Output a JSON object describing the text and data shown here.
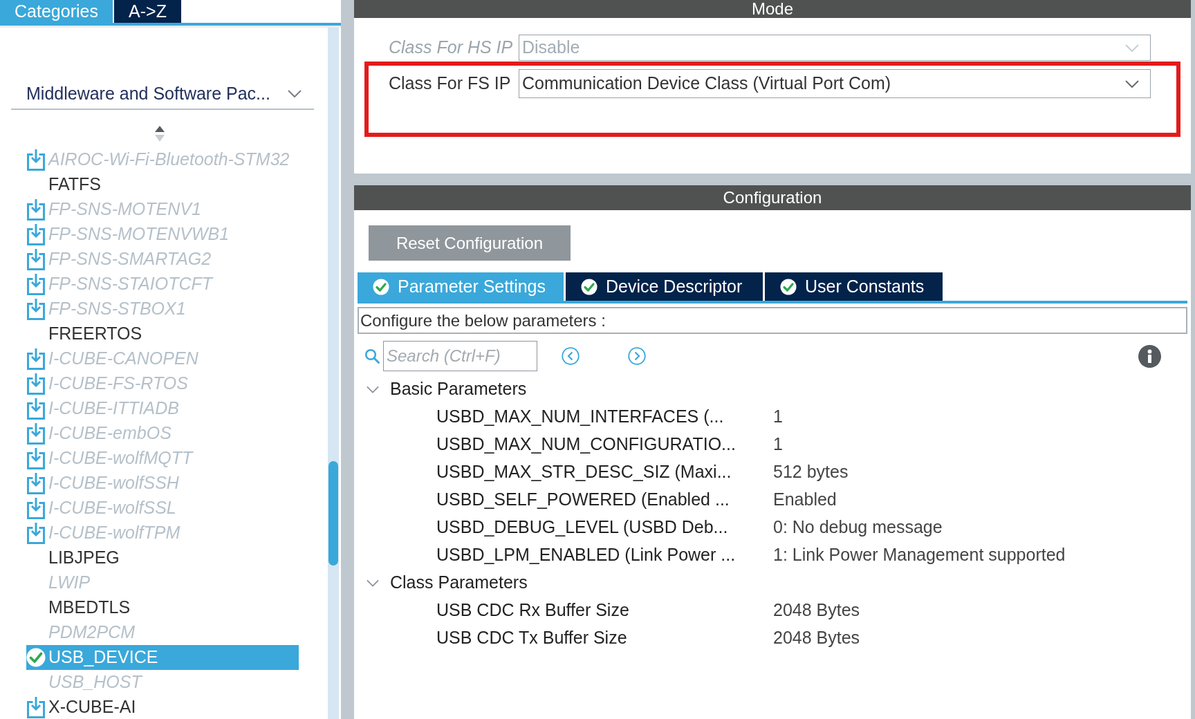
{
  "sidebar": {
    "tabs": [
      {
        "label": "Categories",
        "selected": true
      },
      {
        "label": "A->Z",
        "selected": false
      }
    ],
    "category_dropdown": {
      "value": "Middleware and Software Pac..."
    },
    "items": [
      {
        "label": "AIROC-Wi-Fi-Bluetooth-STM32",
        "kind": "pack",
        "available": false,
        "configured": false,
        "selected": false
      },
      {
        "label": "FATFS",
        "kind": "component",
        "available": true,
        "configured": false,
        "selected": false
      },
      {
        "label": "FP-SNS-MOTENV1",
        "kind": "pack",
        "available": false,
        "configured": false,
        "selected": false
      },
      {
        "label": "FP-SNS-MOTENVWB1",
        "kind": "pack",
        "available": false,
        "configured": false,
        "selected": false
      },
      {
        "label": "FP-SNS-SMARTAG2",
        "kind": "pack",
        "available": false,
        "configured": false,
        "selected": false
      },
      {
        "label": "FP-SNS-STAIOTCFT",
        "kind": "pack",
        "available": false,
        "configured": false,
        "selected": false
      },
      {
        "label": "FP-SNS-STBOX1",
        "kind": "pack",
        "available": false,
        "configured": false,
        "selected": false
      },
      {
        "label": "FREERTOS",
        "kind": "component",
        "available": true,
        "configured": false,
        "selected": false
      },
      {
        "label": "I-CUBE-CANOPEN",
        "kind": "pack",
        "available": false,
        "configured": false,
        "selected": false
      },
      {
        "label": "I-CUBE-FS-RTOS",
        "kind": "pack",
        "available": false,
        "configured": false,
        "selected": false
      },
      {
        "label": "I-CUBE-ITTIADB",
        "kind": "pack",
        "available": false,
        "configured": false,
        "selected": false
      },
      {
        "label": "I-CUBE-embOS",
        "kind": "pack",
        "available": false,
        "configured": false,
        "selected": false
      },
      {
        "label": "I-CUBE-wolfMQTT",
        "kind": "pack",
        "available": false,
        "configured": false,
        "selected": false
      },
      {
        "label": "I-CUBE-wolfSSH",
        "kind": "pack",
        "available": false,
        "configured": false,
        "selected": false
      },
      {
        "label": "I-CUBE-wolfSSL",
        "kind": "pack",
        "available": false,
        "configured": false,
        "selected": false
      },
      {
        "label": "I-CUBE-wolfTPM",
        "kind": "pack",
        "available": false,
        "configured": false,
        "selected": false
      },
      {
        "label": "LIBJPEG",
        "kind": "component",
        "available": true,
        "configured": false,
        "selected": false
      },
      {
        "label": "LWIP",
        "kind": "component",
        "available": false,
        "configured": false,
        "selected": false
      },
      {
        "label": "MBEDTLS",
        "kind": "component",
        "available": true,
        "configured": false,
        "selected": false
      },
      {
        "label": "PDM2PCM",
        "kind": "component",
        "available": false,
        "configured": false,
        "selected": false
      },
      {
        "label": "USB_DEVICE",
        "kind": "component",
        "available": true,
        "configured": true,
        "selected": true
      },
      {
        "label": "USB_HOST",
        "kind": "component",
        "available": false,
        "configured": false,
        "selected": false
      },
      {
        "label": "X-CUBE-AI",
        "kind": "pack",
        "available": true,
        "configured": false,
        "selected": false
      }
    ]
  },
  "mode": {
    "title": "Mode",
    "fields": [
      {
        "label": "Class For HS IP",
        "value": "Disable",
        "disabled": true,
        "highlighted": false
      },
      {
        "label": "Class For FS IP",
        "value": "Communication Device Class (Virtual Port Com)",
        "disabled": false,
        "highlighted": true
      }
    ]
  },
  "configuration": {
    "title": "Configuration",
    "reset_button": "Reset Configuration",
    "tabs": [
      {
        "label": "Parameter Settings",
        "selected": true,
        "valid": true
      },
      {
        "label": "Device Descriptor",
        "selected": false,
        "valid": true
      },
      {
        "label": "User Constants",
        "selected": false,
        "valid": true
      }
    ],
    "hint": "Configure the below parameters :",
    "search": {
      "placeholder": "Search (Ctrl+F)"
    },
    "groups": [
      {
        "label": "Basic Parameters",
        "expanded": true,
        "children": [
          {
            "name": "USBD_MAX_NUM_INTERFACES (...",
            "value": "1"
          },
          {
            "name": "USBD_MAX_NUM_CONFIGURATIO...",
            "value": "1"
          },
          {
            "name": "USBD_MAX_STR_DESC_SIZ (Maxi...",
            "value": "512 bytes"
          },
          {
            "name": "USBD_SELF_POWERED (Enabled ...",
            "value": "Enabled"
          },
          {
            "name": "USBD_DEBUG_LEVEL (USBD Deb...",
            "value": "0: No debug message"
          },
          {
            "name": "USBD_LPM_ENABLED (Link Power ...",
            "value": "1: Link Power Management supported"
          }
        ]
      },
      {
        "label": "Class Parameters",
        "expanded": true,
        "children": [
          {
            "name": "USB CDC Rx Buffer Size",
            "value": "2048 Bytes"
          },
          {
            "name": "USB CDC Tx Buffer Size",
            "value": "2048 Bytes"
          }
        ]
      }
    ]
  }
}
